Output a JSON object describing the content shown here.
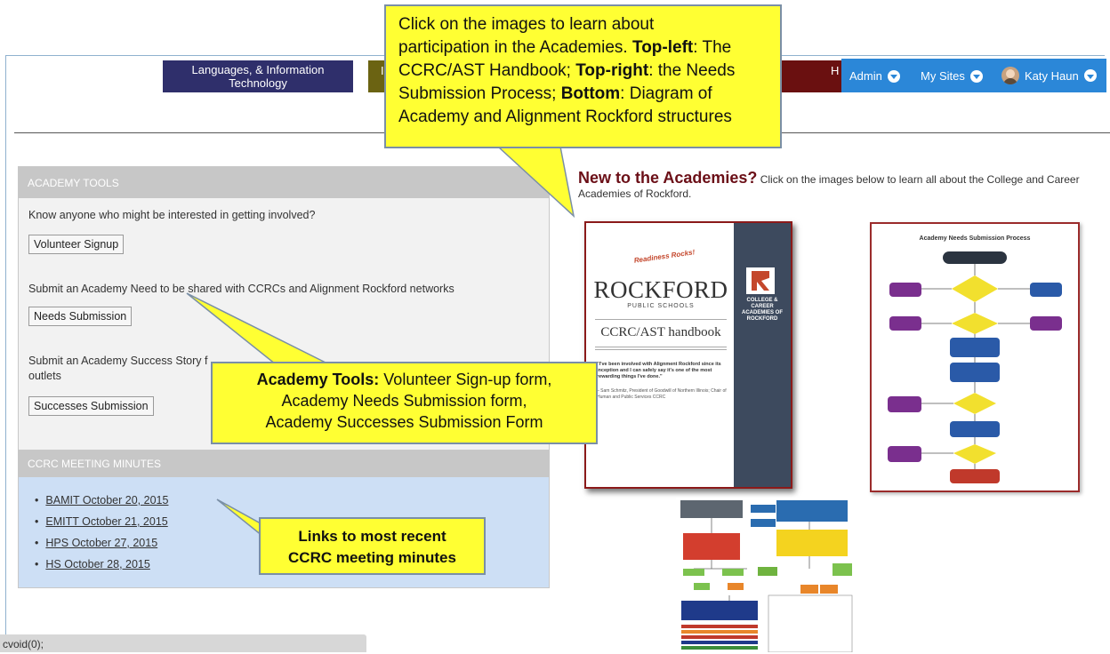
{
  "top_nav": {
    "tile_1_label": "Languages, & Information Technology",
    "tile_2_label": "I",
    "tile_3_label": "H"
  },
  "suite_bar": {
    "admin": "Admin",
    "my_sites": "My Sites",
    "user_name": "Katy Haun"
  },
  "academy_tools": {
    "header": "ACADEMY TOOLS",
    "volunteer_prompt": "Know anyone who might be interested in getting involved?",
    "volunteer_button": "Volunteer Signup",
    "needs_prompt": "Submit an Academy Need to be shared with CCRCs and Alignment Rockford networks",
    "needs_button": "Needs Submission",
    "success_prompt_start": "Submit an Academy Success Story f",
    "success_prompt_end": "outlets",
    "success_button": "Successes Submission"
  },
  "meeting_minutes": {
    "header": "CCRC MEETING MINUTES",
    "links": [
      "BAMIT October 20, 2015",
      "EMITT October 21, 2015",
      "HPS October 27, 2015",
      "HS October 28, 2015"
    ]
  },
  "intro": {
    "heading": "New to the Academies?",
    "text": " Click on the images below to learn all about the College and Career Academies of Rockford."
  },
  "handbook": {
    "tagline": "Readiness Rocks!",
    "district": "ROCKFORD",
    "district_sub": "PUBLIC SCHOOLS",
    "title": "CCRC/AST handbook",
    "quote": "\"I've been involved with Alignment Rockford since its inception and I can safely say it's one of the most rewarding things I've done.\"",
    "attribution": "– Sam Schmitz, President of Goodwill of Northern Illinois; Chair of Human and Public Services CCRC",
    "band_text": "COLLEGE & CAREER ACADEMIES OF ROCKFORD"
  },
  "needs_process": {
    "title": "Academy Needs Submission Process"
  },
  "callouts": {
    "top_line1": "Click on the images to learn about",
    "top_line2_a": "participation in the Academies. ",
    "top_line2_b": "Top-left",
    "top_line2_c": ": The",
    "top_line3_a": "CCRC/AST Handbook; ",
    "top_line3_b": "Top-right",
    "top_line3_c": ": the Needs",
    "top_line4_a": "Submission Process; ",
    "top_line4_b": "Bottom",
    "top_line4_c": ": Diagram of",
    "top_line5": "Academy and Alignment Rockford structures",
    "tools_bold": "Academy Tools:",
    "tools_line1_rest": " Volunteer Sign-up form,",
    "tools_line2": "Academy Needs Submission form,",
    "tools_line3": "Academy Successes Submission Form",
    "minutes_line1": "Links to most recent",
    "minutes_line2": "CCRC meeting minutes"
  },
  "status_bar": {
    "text": "cvoid(0);"
  },
  "colors": {
    "suite_blue": "#2b87d8",
    "callout_yellow": "#ffff33",
    "intro_heading": "#6b0f17",
    "minutes_bg": "#cddff5"
  }
}
